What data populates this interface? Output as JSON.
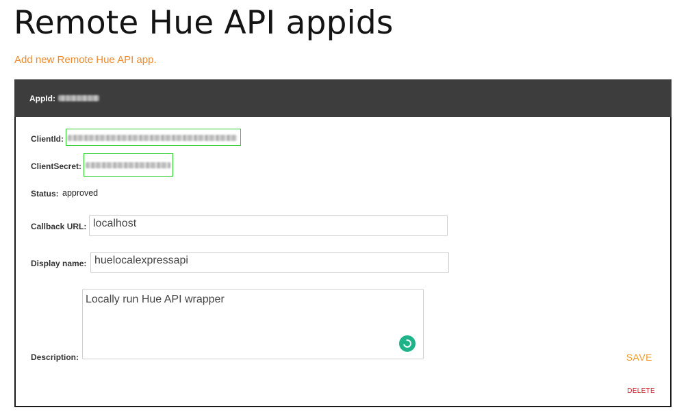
{
  "page": {
    "title": "Remote Hue API appids",
    "add_link": "Add new Remote Hue API app."
  },
  "app": {
    "appid_label": "AppId:",
    "client_id_label": "ClientId:",
    "client_secret_label": "ClientSecret:",
    "status_label": "Status:",
    "status_value": "approved",
    "callback_label": "Callback URL:",
    "callback_value": "localhost",
    "display_name_label": "Display name:",
    "display_name_value": "huelocalexpressapi",
    "description_label": "Description:",
    "description_value": "Locally run Hue API wrapper",
    "save_label": "SAVE",
    "delete_label": "DELETE"
  },
  "icons": {
    "spinner": "loading-spinner-icon"
  },
  "colors": {
    "accent": "#ee8a2a",
    "header_bg": "#3d3d3d",
    "delete": "#d0202a",
    "highlight": "#2ecc2e",
    "badge": "#1fb38a"
  }
}
